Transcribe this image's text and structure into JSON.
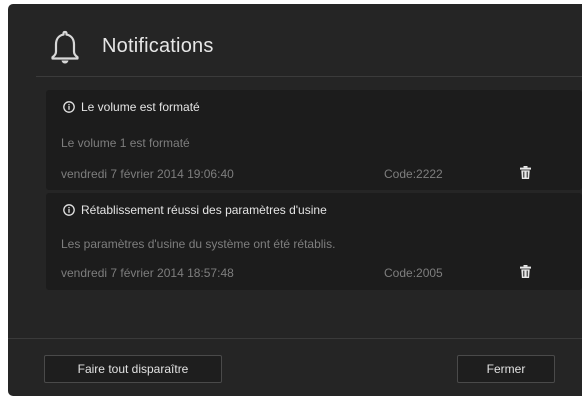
{
  "dialog": {
    "title": "Notifications",
    "icon": "bell-icon"
  },
  "notifications": [
    {
      "title": "Le volume est formaté",
      "message": "Le volume 1 est formaté",
      "date": "vendredi 7 février 2014 19:06:40",
      "code": "Code:2222",
      "icon": "info-icon",
      "delete_icon": "trash-icon"
    },
    {
      "title": "Rétablissement réussi des paramètres d'usine",
      "message": "Les paramètres d'usine du système ont été rétablis.",
      "date": "vendredi 7 février 2014 18:57:48",
      "code": "Code:2005",
      "icon": "info-icon",
      "delete_icon": "trash-icon"
    }
  ],
  "footer": {
    "clear_all_label": "Faire tout disparaître",
    "close_label": "Fermer"
  },
  "colors": {
    "background": "#252525",
    "card": "#1c1c1c",
    "text_primary": "#e4e4e4",
    "text_secondary": "#7e7e7e"
  }
}
